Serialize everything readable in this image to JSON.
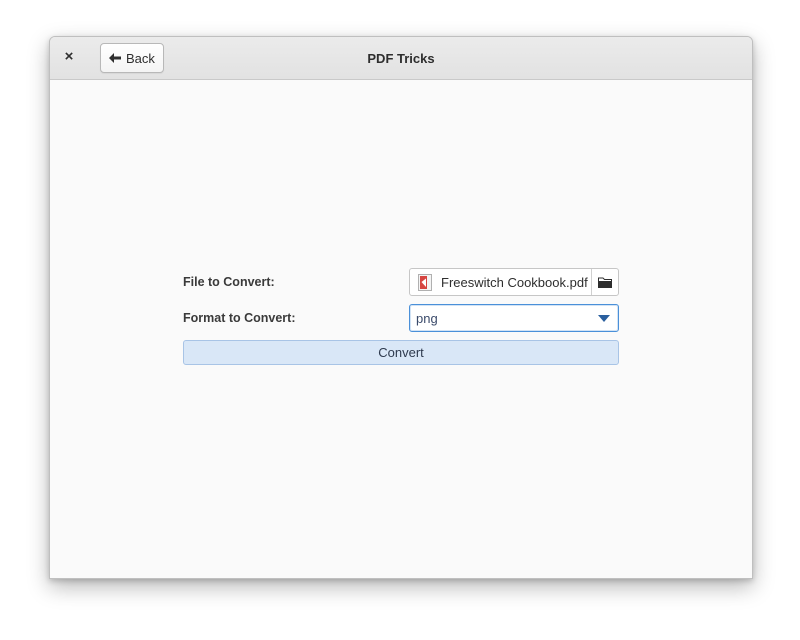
{
  "window": {
    "title": "PDF Tricks"
  },
  "headerbar": {
    "close_label": "×",
    "back_label": "Back"
  },
  "form": {
    "file_label": "File to Convert:",
    "file_value": "Freeswitch Cookbook.pdf",
    "format_label": "Format to Convert:",
    "format_value": "png",
    "convert_label": "Convert"
  },
  "icons": {
    "back": "left-arrow-icon",
    "file": "pdf-file-icon",
    "folder": "folder-icon",
    "dropdown": "chevron-down-icon"
  },
  "colors": {
    "accent": "#4a90d9",
    "convert_button": "#d9e7f7"
  }
}
